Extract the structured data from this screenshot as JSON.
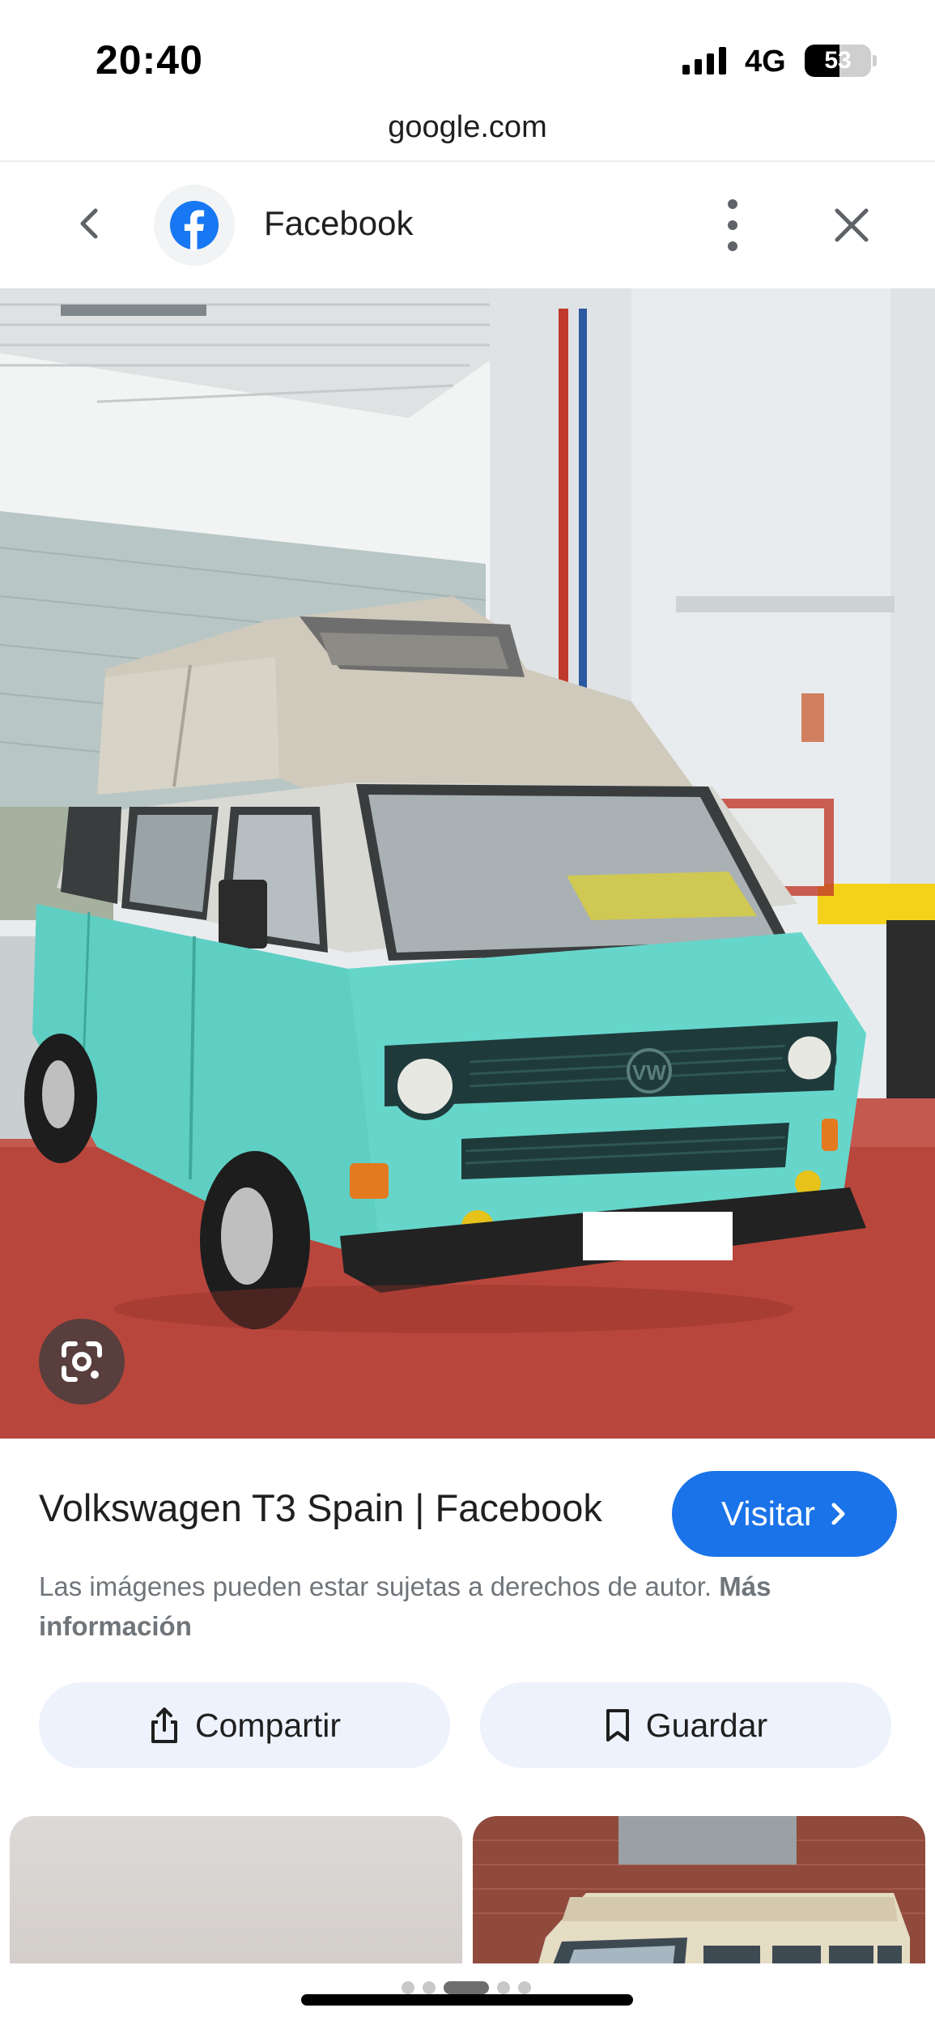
{
  "status_bar": {
    "time": "20:40",
    "network": "4G",
    "battery": "53",
    "battery_level_percent": 53
  },
  "browser": {
    "domain": "google.com"
  },
  "header": {
    "title": "Facebook",
    "icons": [
      "chevron-left-icon",
      "facebook-logo",
      "more-vert-icon",
      "close-icon"
    ]
  },
  "result": {
    "title": "Volkswagen T3 Spain | Facebook",
    "visit_label": "Visitar",
    "copyright_text": "Las imágenes pueden estar sujetas a derechos de autor.",
    "more_info_label": "Más información"
  },
  "actions": {
    "share_label": "Compartir",
    "save_label": "Guardar"
  },
  "colors": {
    "accent": "#1a73e8",
    "pill_bg": "#edf2fc",
    "van_body": "#5fcfc4",
    "van_roof": "#cfcabc",
    "floor": "#b9463c"
  }
}
